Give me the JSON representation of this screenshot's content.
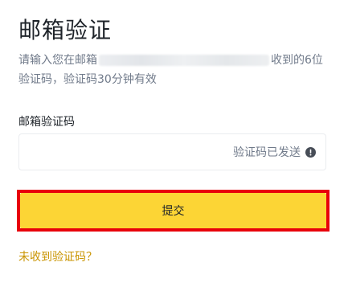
{
  "page": {
    "title": "邮箱验证",
    "description_prefix": "请输入您在邮箱",
    "description_suffix": "收到的6位验证码，验证码30分钟有效"
  },
  "form": {
    "code_label": "邮箱验证码",
    "code_value": "",
    "code_status": "验证码已发送",
    "status_icon": "info-icon"
  },
  "actions": {
    "submit_label": "提交",
    "resend_link": "未收到验证码？"
  },
  "colors": {
    "accent_button": "#fcd535",
    "highlight_border": "#e8000b",
    "link": "#c99400",
    "text_primary": "#1e2329",
    "text_secondary": "#707a8a"
  }
}
